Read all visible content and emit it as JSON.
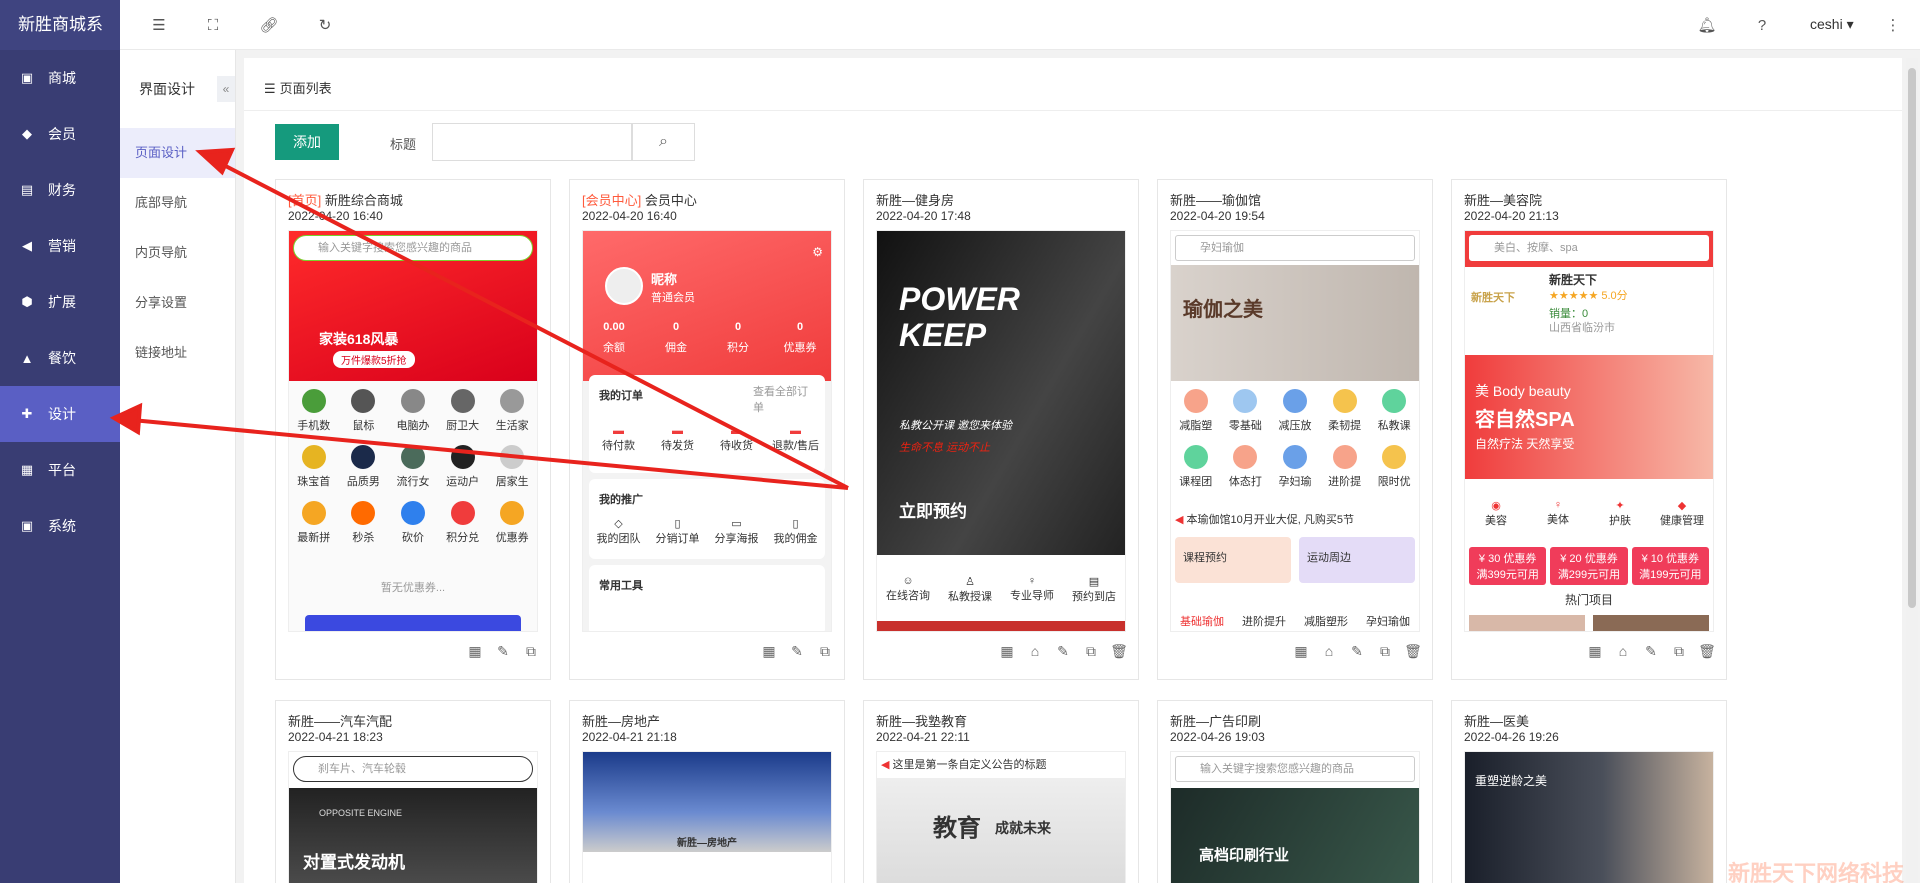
{
  "app": {
    "logo": "新胜商城系"
  },
  "sidebar": {
    "items": [
      {
        "label": "商城",
        "icon": "shop-icon"
      },
      {
        "label": "会员",
        "icon": "member-icon"
      },
      {
        "label": "财务",
        "icon": "finance-icon"
      },
      {
        "label": "营销",
        "icon": "marketing-icon"
      },
      {
        "label": "扩展",
        "icon": "extend-icon"
      },
      {
        "label": "餐饮",
        "icon": "catering-icon"
      },
      {
        "label": "设计",
        "icon": "puzzle-icon",
        "active": true
      },
      {
        "label": "平台",
        "icon": "platform-icon"
      },
      {
        "label": "系统",
        "icon": "system-icon"
      }
    ]
  },
  "subnav": {
    "title": "界面设计",
    "collapse": "«",
    "items": [
      "页面设计",
      "底部导航",
      "内页导航",
      "分享设置",
      "链接地址"
    ]
  },
  "topbar": {
    "user": "ceshi"
  },
  "main": {
    "title": "页面列表",
    "add_label": "添加",
    "title_label": "标题",
    "search_placeholder": ""
  },
  "cards": [
    {
      "tag": "[首页]",
      "title": "新胜综合商城",
      "date": "2022-04-20 16:40",
      "search": "输入关键字搜索您感兴趣的商品",
      "banner": "家装618风暴",
      "banner_sub": "万件爆款5折抢",
      "grid": [
        "手机数",
        "鼠标",
        "电脑办",
        "厨卫大",
        "生活家",
        "珠宝首",
        "品质男",
        "流行女",
        "运动户",
        "居家生",
        "最新拼",
        "秒杀",
        "砍价",
        "积分兑",
        "优惠券"
      ],
      "footer": "暂无优惠券..."
    },
    {
      "tag": "[会员中心]",
      "title": "会员中心",
      "date": "2022-04-20 16:40",
      "nickname": "昵称",
      "level": "普通会员",
      "stats": [
        {
          "v": "0.00",
          "l": "余额"
        },
        {
          "v": "0",
          "l": "佣金"
        },
        {
          "v": "0",
          "l": "积分"
        },
        {
          "v": "0",
          "l": "优惠券"
        }
      ],
      "orders_title": "我的订单",
      "orders_more": "查看全部订单",
      "orders": [
        "待付款",
        "待发货",
        "待收货",
        "退款/售后"
      ],
      "promo_title": "我的推广",
      "promo": [
        "我的团队",
        "分销订单",
        "分享海报",
        "我的佣金"
      ],
      "tools_title": "常用工具"
    },
    {
      "tag": "",
      "title": "新胜—健身房",
      "date": "2022-04-20 17:48",
      "hero1": "POWER",
      "hero2": "KEEP",
      "hero_sub": "私教公开课 邀您来体验",
      "hero_red": "生命不息 运动不止",
      "cta": "立即预约",
      "grid": [
        "在线咨询",
        "私教授课",
        "专业导师",
        "预约到店"
      ]
    },
    {
      "tag": "",
      "title": "新胜——瑜伽馆",
      "date": "2022-04-20 19:54",
      "search": "孕妇瑜伽",
      "hero": "瑜伽之美",
      "grid": [
        "减脂塑",
        "零基础",
        "减压放",
        "柔韧提",
        "私教课",
        "课程团",
        "体态打",
        "孕妇瑜",
        "进阶提",
        "限时优"
      ],
      "notice": "本瑜伽馆10月开业大促, 凡购买5节",
      "box1": "课程预约",
      "box2": "运动周边",
      "tabs": [
        "基础瑜伽",
        "进阶提升",
        "减脂塑形",
        "孕妇瑜伽"
      ]
    },
    {
      "tag": "",
      "title": "新胜—美容院",
      "date": "2022-04-20 21:13",
      "search": "美白、按摩、spa",
      "shop": "新胜天下",
      "rating": "5.0分",
      "sales": "销量：0",
      "city": "山西省临汾市",
      "banner1": "美 Body beauty",
      "banner2": "容自然SPA",
      "banner3": "自然疗法 天然享受",
      "grid": [
        "美容",
        "美体",
        "护肤",
        "健康管理"
      ],
      "coupons": [
        {
          "v": "¥ 30 优惠券",
          "c": "满399元可用"
        },
        {
          "v": "¥ 20 优惠券",
          "c": "满299元可用"
        },
        {
          "v": "¥ 10 优惠券",
          "c": "满199元可用"
        }
      ],
      "hot": "热门项目"
    },
    {
      "tag": "",
      "title": "新胜——汽车汽配",
      "date": "2022-04-21 18:23",
      "search": "刹车片、汽车轮毂",
      "hero": "对置式发动机",
      "hero_top": "OPPOSITE ENGINE"
    },
    {
      "tag": "",
      "title": "新胜—房地产",
      "date": "2022-04-21 21:18",
      "hero": "新胜—房地产"
    },
    {
      "tag": "",
      "title": "新胜—我塾教育",
      "date": "2022-04-21 22:11",
      "notice": "这里是第一条自定义公告的标题",
      "hero": "教育",
      "hero2": "成就未来"
    },
    {
      "tag": "",
      "title": "新胜—广告印刷",
      "date": "2022-04-26 19:03",
      "search": "输入关键字搜索您感兴趣的商品",
      "hero": "高档印刷行业"
    },
    {
      "tag": "",
      "title": "新胜—医美",
      "date": "2022-04-26 19:26",
      "hero": "重塑逆龄之美"
    }
  ],
  "watermark": "新胜天下网络科技"
}
